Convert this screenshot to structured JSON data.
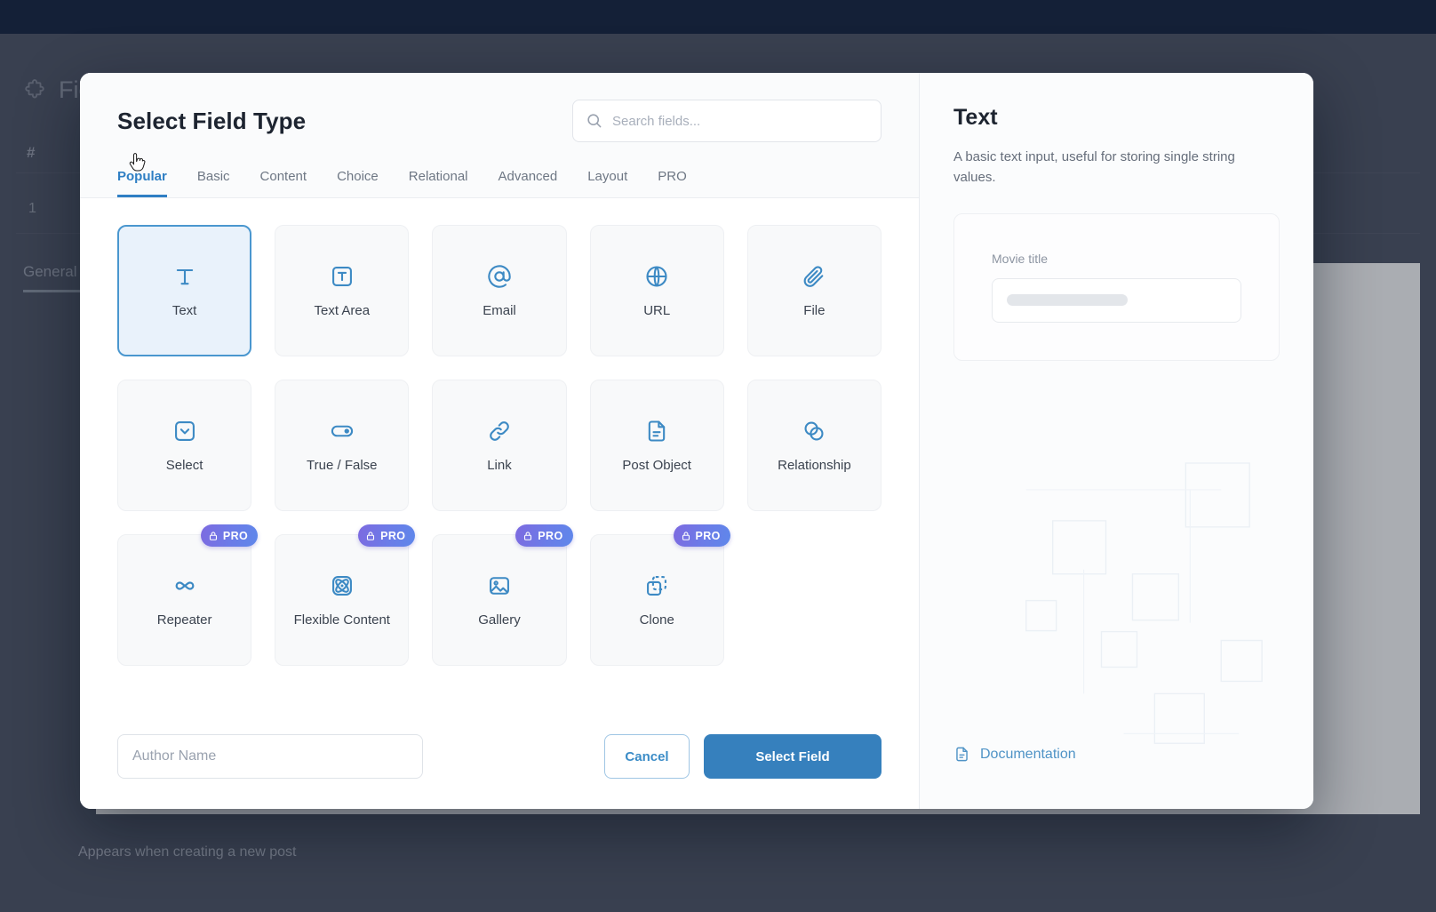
{
  "background": {
    "heading": "Field",
    "heading_icon": "puzzle-icon",
    "column_hash": "#",
    "row_number": "1",
    "tab_label": "General",
    "caption": "Appears when creating a new post"
  },
  "modal": {
    "title": "Select Field Type",
    "search": {
      "placeholder": "Search fields...",
      "value": "",
      "icon": "search-icon"
    },
    "tabs": [
      {
        "label": "Popular",
        "active": true
      },
      {
        "label": "Basic",
        "active": false
      },
      {
        "label": "Content",
        "active": false
      },
      {
        "label": "Choice",
        "active": false
      },
      {
        "label": "Relational",
        "active": false
      },
      {
        "label": "Advanced",
        "active": false
      },
      {
        "label": "Layout",
        "active": false
      },
      {
        "label": "PRO",
        "active": false
      }
    ],
    "field_types": [
      {
        "label": "Text",
        "icon": "text-t-icon",
        "selected": true,
        "pro": false
      },
      {
        "label": "Text Area",
        "icon": "text-area-icon",
        "selected": false,
        "pro": false
      },
      {
        "label": "Email",
        "icon": "at-sign-icon",
        "selected": false,
        "pro": false
      },
      {
        "label": "URL",
        "icon": "globe-icon",
        "selected": false,
        "pro": false
      },
      {
        "label": "File",
        "icon": "paperclip-icon",
        "selected": false,
        "pro": false
      },
      {
        "label": "Select",
        "icon": "select-dropdown-icon",
        "selected": false,
        "pro": false
      },
      {
        "label": "True / False",
        "icon": "toggle-icon",
        "selected": false,
        "pro": false
      },
      {
        "label": "Link",
        "icon": "link-chain-icon",
        "selected": false,
        "pro": false
      },
      {
        "label": "Post Object",
        "icon": "document-icon",
        "selected": false,
        "pro": false
      },
      {
        "label": "Relationship",
        "icon": "overlapping-circles-icon",
        "selected": false,
        "pro": false
      },
      {
        "label": "Repeater",
        "icon": "infinity-icon",
        "selected": false,
        "pro": true
      },
      {
        "label": "Flexible Content",
        "icon": "atom-icon",
        "selected": false,
        "pro": true
      },
      {
        "label": "Gallery",
        "icon": "image-icon",
        "selected": false,
        "pro": true
      },
      {
        "label": "Clone",
        "icon": "clone-squares-icon",
        "selected": false,
        "pro": true
      }
    ],
    "pro_badge_label": "PRO",
    "footer": {
      "name_input_placeholder": "Author Name",
      "name_input_value": "",
      "cancel_label": "Cancel",
      "submit_label": "Select Field"
    }
  },
  "preview": {
    "title": "Text",
    "description": "A basic text input, useful for storing single string values.",
    "example_field_label": "Movie title",
    "documentation_label": "Documentation",
    "documentation_icon": "document-icon"
  },
  "colors": {
    "accent_blue": "#3680bd",
    "icon_blue": "#3d8ac4",
    "selected_card_bg": "#e9f2fb",
    "selected_card_border": "#4a97cf",
    "pro_gradient_start": "#7d6ae0",
    "pro_gradient_end": "#5f87ea",
    "topbar_navy": "#16243f",
    "overlay_grey": "#4b5263"
  }
}
